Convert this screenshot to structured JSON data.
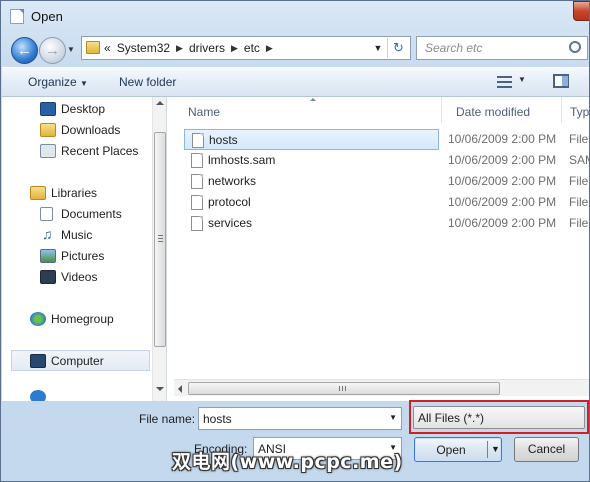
{
  "window": {
    "title": "Open"
  },
  "address_bar": {
    "overflow": "«",
    "crumbs": [
      "System32",
      "drivers",
      "etc"
    ]
  },
  "search": {
    "placeholder": "Search etc"
  },
  "toolbar": {
    "organize_label": "Organize",
    "new_folder_label": "New folder"
  },
  "nav_pane": {
    "favorites": [
      {
        "label": "Desktop",
        "icon": "desktop-icon"
      },
      {
        "label": "Downloads",
        "icon": "downloads-icon"
      },
      {
        "label": "Recent Places",
        "icon": "recent-places-icon"
      }
    ],
    "libraries": {
      "label": "Libraries",
      "items": [
        {
          "label": "Documents",
          "icon": "documents-icon"
        },
        {
          "label": "Music",
          "icon": "music-icon"
        },
        {
          "label": "Pictures",
          "icon": "pictures-icon"
        },
        {
          "label": "Videos",
          "icon": "videos-icon"
        }
      ]
    },
    "homegroup": {
      "label": "Homegroup"
    },
    "computer": {
      "label": "Computer"
    }
  },
  "file_list": {
    "columns": [
      "Name",
      "Date modified",
      "Type"
    ],
    "rows": [
      {
        "name": "hosts",
        "date": "10/06/2009 2:00 PM",
        "type": "File",
        "selected": true
      },
      {
        "name": "lmhosts.sam",
        "date": "10/06/2009 2:00 PM",
        "type": "SAM",
        "selected": false
      },
      {
        "name": "networks",
        "date": "10/06/2009 2:00 PM",
        "type": "File",
        "selected": false
      },
      {
        "name": "protocol",
        "date": "10/06/2009 2:00 PM",
        "type": "File",
        "selected": false
      },
      {
        "name": "services",
        "date": "10/06/2009 2:00 PM",
        "type": "File",
        "selected": false
      }
    ]
  },
  "bottom": {
    "file_name_label": "File name:",
    "file_name_value": "hosts",
    "filter_value": "All Files  (*.*)",
    "encoding_label": "Encoding:",
    "encoding_value": "ANSI",
    "open_label": "Open",
    "cancel_label": "Cancel"
  },
  "watermark": "双电网(www.pcpc.me)",
  "colors": {
    "highlight": "#d21f1f",
    "selection": "#d6e8fc",
    "accent": "#3d7bc9"
  }
}
